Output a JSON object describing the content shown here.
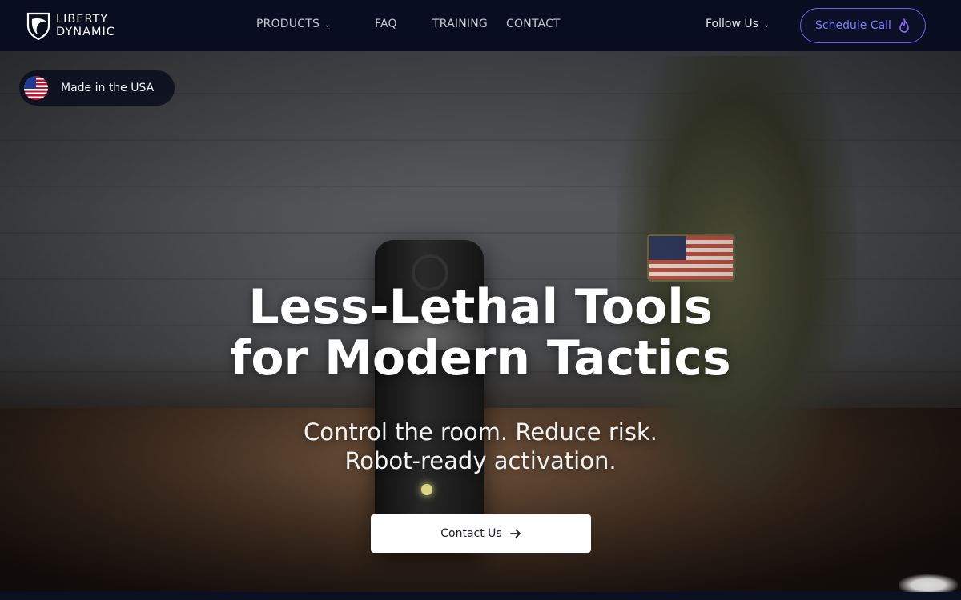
{
  "brand": {
    "name_line1": "LIBERTY",
    "name_line2": "DYNAMIC"
  },
  "nav": {
    "products": "PRODUCTS",
    "faq": "FAQ",
    "training": "TRAINING",
    "contact": "CONTACT",
    "follow_us": "Follow Us",
    "schedule_call": "Schedule Call"
  },
  "badge": {
    "label": "Made in the USA"
  },
  "hero": {
    "headline_line1": "Less-Lethal Tools",
    "headline_line2": "for Modern Tactics",
    "sub_line1": "Control the room. Reduce risk.",
    "sub_line2": "Robot-ready activation.",
    "cta": "Contact Us"
  },
  "colors": {
    "nav_bg": "#080d1f",
    "accent": "#6b63f5",
    "flag_red": "#c8102e",
    "flag_blue": "#1f3a93"
  },
  "icons": [
    "shield-logo-icon",
    "chevron-down-icon",
    "flame-icon",
    "us-flag-icon",
    "arrow-right-icon"
  ]
}
